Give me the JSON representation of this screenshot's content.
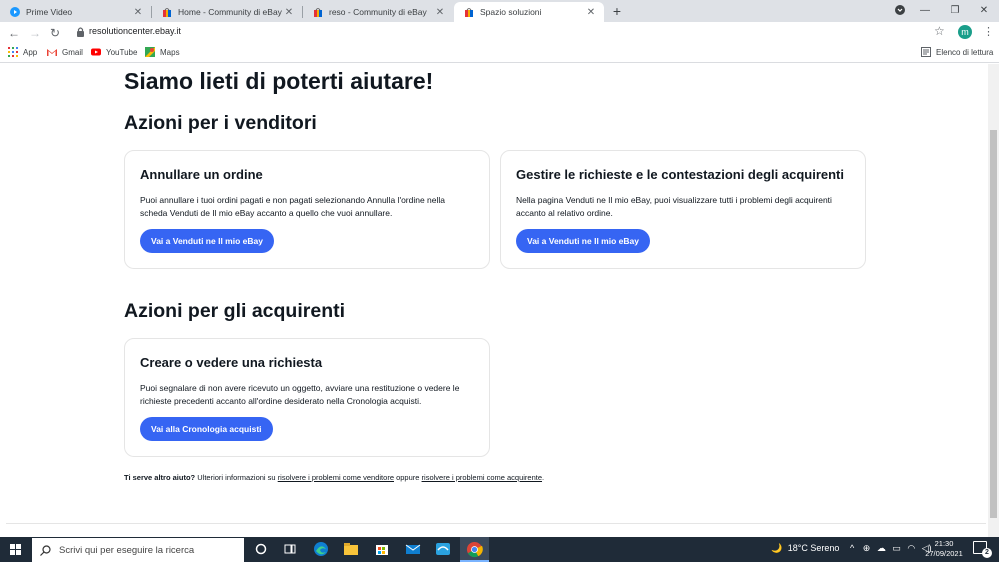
{
  "browser": {
    "tabs": [
      {
        "label": "Prime Video",
        "icon": "play-icon"
      },
      {
        "label": "Home - Community di eBay",
        "icon": "ebay-bag-icon"
      },
      {
        "label": "reso - Community di eBay",
        "icon": "ebay-bag-icon"
      },
      {
        "label": "Spazio soluzioni",
        "icon": "ebay-bag-icon"
      }
    ],
    "url": "resolutioncenter.ebay.it",
    "avatar_letter": "m",
    "bookmarks": [
      {
        "label": "App",
        "icon": "apps-grid-icon"
      },
      {
        "label": "Gmail",
        "icon": "gmail-icon"
      },
      {
        "label": "YouTube",
        "icon": "youtube-icon"
      },
      {
        "label": "Maps",
        "icon": "maps-icon"
      }
    ],
    "reading_list": "Elenco di lettura"
  },
  "page": {
    "title": "Siamo lieti di poterti aiutare!",
    "sellers": {
      "heading": "Azioni per i venditori",
      "cards": [
        {
          "title": "Annullare un ordine",
          "text": "Puoi annullare i tuoi ordini pagati e non pagati selezionando Annulla l'ordine nella scheda Venduti de Il mio eBay accanto a quello che vuoi annullare.",
          "button": "Vai a Venduti ne Il mio eBay"
        },
        {
          "title": "Gestire le richieste e le contestazioni degli acquirenti",
          "text": "Nella pagina Venduti ne Il mio eBay, puoi visualizzare tutti i problemi degli acquirenti accanto al relativo ordine.",
          "button": "Vai a Venduti ne Il mio eBay"
        }
      ]
    },
    "buyers": {
      "heading": "Azioni per gli acquirenti",
      "cards": [
        {
          "title": "Creare o vedere una richiesta",
          "text": "Puoi segnalare di non avere ricevuto un oggetto, avviare una restituzione o vedere le richieste precedenti accanto all'ordine desiderato nella Cronologia acquisti.",
          "button": "Vai alla Cronologia acquisti"
        }
      ]
    },
    "help": {
      "lead": "Ti serve altro aiuto?",
      "text1": "Ulteriori informazioni su",
      "link1": "risolvere i problemi come venditore",
      "text2": "oppure",
      "link2": "risolvere i problemi come acquirente",
      "end": "."
    }
  },
  "taskbar": {
    "search_placeholder": "Scrivi qui per eseguire la ricerca",
    "weather": "18°C  Sereno",
    "time": "21:30",
    "date": "27/09/2021",
    "notifications": "2"
  },
  "colors": {
    "primary_button": "#3665f3",
    "text": "#111820",
    "taskbar": "#1f2b38",
    "tabstrip": "#dee1e6"
  }
}
